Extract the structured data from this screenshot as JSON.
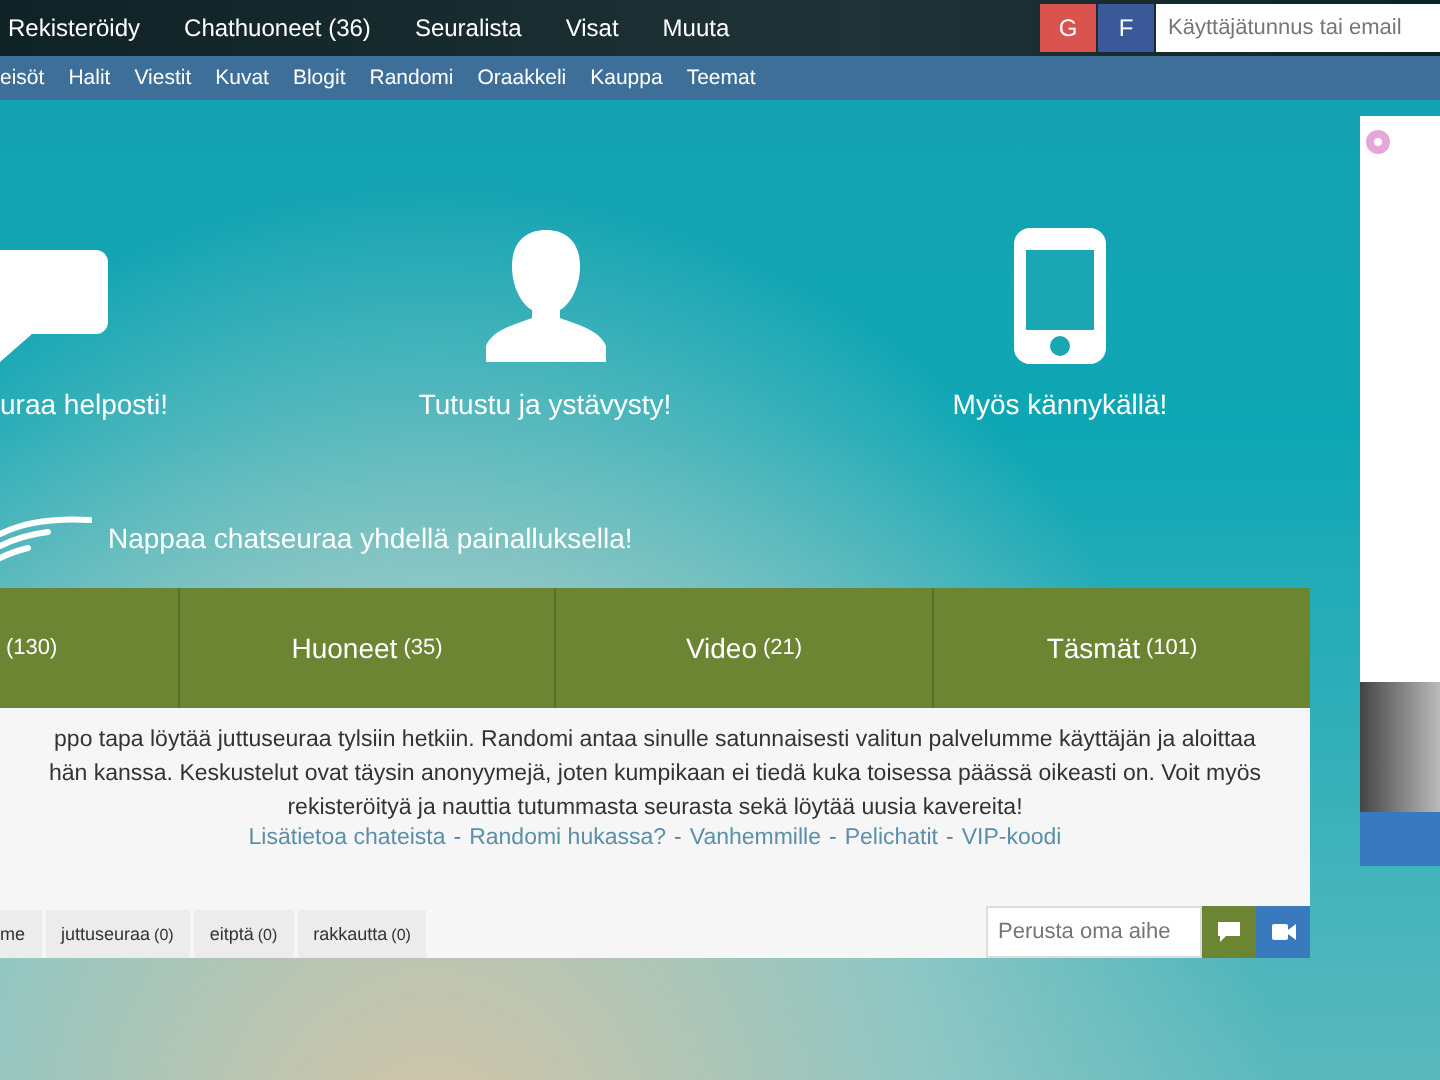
{
  "top_nav": {
    "items": [
      "Rekisteröidy",
      "Chathuoneet (36)",
      "Seuralista",
      "Visat",
      "Muuta"
    ],
    "login": [
      {
        "kind": "google",
        "label": "G"
      },
      {
        "kind": "facebook",
        "label": "F"
      }
    ],
    "username": {
      "placeholder": "Käyttäjätunnus tai email"
    }
  },
  "sub_nav": {
    "items": [
      "eisöt",
      "Halit",
      "Viestit",
      "Kuvat",
      "Blogit",
      "Randomi",
      "Oraakkeli",
      "Kauppa",
      "Teemat"
    ]
  },
  "features": [
    {
      "kind": "chat",
      "label": "uraa helposti!"
    },
    {
      "kind": "person",
      "label": "Tutustu ja ystävysty!"
    },
    {
      "kind": "phone",
      "label": "Myös kännykällä!"
    }
  ],
  "tagline": "Nappaa chatseuraa yhdellä painalluksella!",
  "tabs": [
    {
      "count": "(130)"
    },
    {
      "label": "Huoneet",
      "count": "(35)"
    },
    {
      "label": "Video",
      "count": "(21)"
    },
    {
      "label": "Täsmät",
      "count": "(101)"
    }
  ],
  "description": [
    "ppo tapa löytää juttuseuraa tylsiin hetkiin. Randomi antaa sinulle satunnaisesti valitun palvelumme käyttäjän ja aloittaa",
    "hän kanssa. Keskustelut ovat täysin anonyymejä, joten kumpikaan ei tiedä kuka toisessa päässä oikeasti on. Voit myös",
    "rekisteröityä ja nauttia tutummasta seurasta sekä löytää uusia kavereita!"
  ],
  "links": [
    "Lisätietoa chateista",
    "Randomi hukassa?",
    "Vanhemmille",
    "Pelichatit",
    "VIP-koodi"
  ],
  "link_separator": "-",
  "topics": [
    {
      "label": "me"
    },
    {
      "label": "juttuseuraa",
      "count": "(0)"
    },
    {
      "label": "eitptä",
      "count": "(0)"
    },
    {
      "label": "rakkautta",
      "count": "(0)"
    }
  ],
  "topic_field": {
    "placeholder": "Perusta oma aihe"
  }
}
